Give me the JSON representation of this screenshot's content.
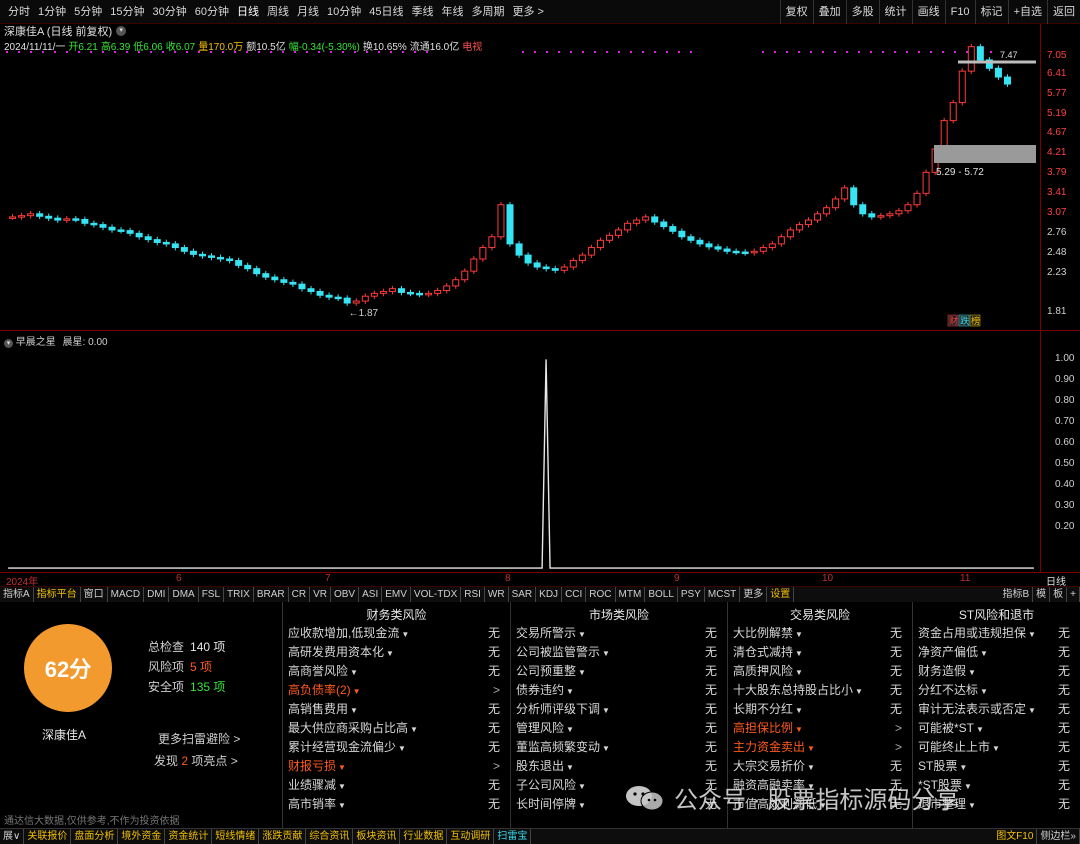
{
  "periods": [
    "分时",
    "1分钟",
    "5分钟",
    "15分钟",
    "30分钟",
    "60分钟",
    "日线",
    "周线",
    "月线",
    "10分钟",
    "45日线",
    "季线",
    "年线",
    "多周期",
    "更多 >"
  ],
  "active_period": "日线",
  "tools": [
    "复权",
    "叠加",
    "多股",
    "统计",
    "画线",
    "F10",
    "标记",
    "+自选",
    "返回"
  ],
  "stock": {
    "title": "深康佳A (日线 前复权)"
  },
  "quote": {
    "date": "2024/11/11/一",
    "open": "开6.21",
    "high": "高6.39",
    "low": "低6.06",
    "close": "收6.07",
    "volume": "量170.0万",
    "amount": "额10.5亿",
    "change": "幅-0.34(-5.30%)",
    "turnover": "换10.65%",
    "float": "流通16.0亿",
    "sector": "电视"
  },
  "colors": {
    "up": "#ff3b3b",
    "down": "#36e4f4",
    "accent": "#f39a2e",
    "warn": "#ff5a1e",
    "bg": "#000000"
  },
  "price_axis": [
    "7.05",
    "6.41",
    "5.77",
    "5.19",
    "4.67",
    "4.21",
    "3.79",
    "3.41",
    "3.07",
    "2.76",
    "2.48",
    "2.23",
    "1.81"
  ],
  "annotations": {
    "low": "←1.87",
    "range": "5.29 - 5.72",
    "high_note": "7.47"
  },
  "badges": {
    "tag1": "财",
    "tag2": "跌",
    "tag3": "榜"
  },
  "indicator": {
    "name": "早晨之星",
    "label": "晨星: 0.00"
  },
  "ind_axis": [
    "1.00",
    "0.90",
    "0.80",
    "0.70",
    "0.60",
    "0.50",
    "0.40",
    "0.30",
    "0.20"
  ],
  "dates": [
    "2024年",
    "6",
    "7",
    "8",
    "9",
    "10",
    "11"
  ],
  "date_axis_label": "日线",
  "ind_tabs": [
    "指标A",
    "指标平台",
    "窗口",
    "MACD",
    "DMI",
    "DMA",
    "FSL",
    "TRIX",
    "BRAR",
    "CR",
    "VR",
    "OBV",
    "ASI",
    "EMV",
    "VOL-TDX",
    "RSI",
    "WR",
    "SAR",
    "KDJ",
    "CCI",
    "ROC",
    "MTM",
    "BOLL",
    "PSY",
    "MCST",
    "更多",
    "设置"
  ],
  "ind_tabs_right": [
    "指标B",
    "模",
    "板",
    "+"
  ],
  "chart_data": {
    "type": "candlestick",
    "x": [
      "2024-05",
      "2024-06",
      "2024-07",
      "2024-08",
      "2024-09",
      "2024-10",
      "2024-11"
    ],
    "y_ticks": [
      7.05,
      6.41,
      5.77,
      5.19,
      4.67,
      4.21,
      3.79,
      3.41,
      3.07,
      2.76,
      2.48,
      2.23,
      1.81
    ],
    "y_scale": "log",
    "ylim": [
      1.7,
      8.0
    ],
    "low_value": 1.87,
    "last": {
      "open": 6.21,
      "high": 6.39,
      "low": 6.06,
      "close": 6.07
    },
    "close_series": [
      3.0,
      3.02,
      3.05,
      3.01,
      2.98,
      2.95,
      2.97,
      2.96,
      2.9,
      2.88,
      2.84,
      2.8,
      2.79,
      2.75,
      2.7,
      2.66,
      2.62,
      2.6,
      2.55,
      2.5,
      2.46,
      2.44,
      2.42,
      2.4,
      2.38,
      2.32,
      2.28,
      2.22,
      2.18,
      2.15,
      2.12,
      2.1,
      2.05,
      2.02,
      1.98,
      1.96,
      1.95,
      1.9,
      1.92,
      1.97,
      2.0,
      2.02,
      2.05,
      2.01,
      2.0,
      1.99,
      2.0,
      2.03,
      2.08,
      2.15,
      2.25,
      2.4,
      2.55,
      2.7,
      3.2,
      2.6,
      2.45,
      2.35,
      2.3,
      2.28,
      2.26,
      2.3,
      2.38,
      2.45,
      2.55,
      2.65,
      2.72,
      2.8,
      2.9,
      2.95,
      3.0,
      2.92,
      2.85,
      2.78,
      2.7,
      2.65,
      2.6,
      2.56,
      2.53,
      2.5,
      2.49,
      2.48,
      2.5,
      2.55,
      2.6,
      2.7,
      2.8,
      2.88,
      2.95,
      3.05,
      3.15,
      3.3,
      3.5,
      3.2,
      3.05,
      3.0,
      3.02,
      3.05,
      3.1,
      3.2,
      3.4,
      3.8,
      4.3,
      5.0,
      5.5,
      6.5,
      7.4,
      6.9,
      6.6,
      6.3,
      6.07
    ],
    "indicator_series": {
      "name": "晨星",
      "peak_index": 59,
      "peak_value": 1.0,
      "baseline": 0.0
    },
    "ind_ylim": [
      0.0,
      1.05
    ]
  },
  "radar": {
    "score": "62分",
    "stock": "深康佳A",
    "total_label": "总检查",
    "total_value": "140 项",
    "risk_label": "风险项",
    "risk_value": "5 项",
    "safe_label": "安全项",
    "safe_value": "135 项",
    "more": "更多扫雷避险 >",
    "found_prefix": "发现",
    "found_count": "2",
    "found_suffix": "项亮点 >",
    "disclaimer": "通达信大数据,仅供参考,不作为投资依据"
  },
  "categories": [
    {
      "title": "财务类风险",
      "items": [
        {
          "label": "应收款增加,低现金流",
          "status": "无",
          "warn": false
        },
        {
          "label": "高研发费用资本化",
          "status": "无",
          "warn": false
        },
        {
          "label": "高商誉风险",
          "status": "无",
          "warn": false
        },
        {
          "label": "高负债率(2)",
          "status": ">",
          "warn": true
        },
        {
          "label": "高销售费用",
          "status": "无",
          "warn": false
        },
        {
          "label": "最大供应商采购占比高",
          "status": "无",
          "warn": false
        },
        {
          "label": "累计经营现金流偏少",
          "status": "无",
          "warn": false
        },
        {
          "label": "财报亏损",
          "status": ">",
          "warn": true
        },
        {
          "label": "业绩骤减",
          "status": "无",
          "warn": false
        },
        {
          "label": "高市销率",
          "status": "无",
          "warn": false
        }
      ]
    },
    {
      "title": "市场类风险",
      "items": [
        {
          "label": "交易所警示",
          "status": "无",
          "warn": false
        },
        {
          "label": "公司被监管警示",
          "status": "无",
          "warn": false
        },
        {
          "label": "公司预重整",
          "status": "无",
          "warn": false
        },
        {
          "label": "债券违约",
          "status": "无",
          "warn": false
        },
        {
          "label": "分析师评级下调",
          "status": "无",
          "warn": false
        },
        {
          "label": "管理风险",
          "status": "无",
          "warn": false
        },
        {
          "label": "董监高频繁变动",
          "status": "无",
          "warn": false
        },
        {
          "label": "股东退出",
          "status": "无",
          "warn": false
        },
        {
          "label": "子公司风险",
          "status": "无",
          "warn": false
        },
        {
          "label": "长时间停牌",
          "status": "无",
          "warn": false
        }
      ]
    },
    {
      "title": "交易类风险",
      "items": [
        {
          "label": "大比例解禁",
          "status": "无",
          "warn": false
        },
        {
          "label": "清仓式减持",
          "status": "无",
          "warn": false
        },
        {
          "label": "高质押风险",
          "status": "无",
          "warn": false
        },
        {
          "label": "十大股东总持股占比小",
          "status": "无",
          "warn": false
        },
        {
          "label": "长期不分红",
          "status": "无",
          "warn": false
        },
        {
          "label": "高担保比例",
          "status": ">",
          "warn": true
        },
        {
          "label": "主力资金卖出",
          "status": ">",
          "warn": true
        },
        {
          "label": "大宗交易折价",
          "status": "无",
          "warn": false
        },
        {
          "label": "融资高融卖率",
          "status": "无",
          "warn": false
        },
        {
          "label": "市值高效利润低",
          "status": "无",
          "warn": false
        }
      ]
    },
    {
      "title": "ST风险和退市",
      "items": [
        {
          "label": "资金占用或违规担保",
          "status": "无",
          "warn": false
        },
        {
          "label": "净资产偏低",
          "status": "无",
          "warn": false
        },
        {
          "label": "财务造假",
          "status": "无",
          "warn": false
        },
        {
          "label": "分红不达标",
          "status": "无",
          "warn": false
        },
        {
          "label": "审计无法表示或否定",
          "status": "无",
          "warn": false
        },
        {
          "label": "可能被*ST",
          "status": "无",
          "warn": false
        },
        {
          "label": "可能终止上市",
          "status": "无",
          "warn": false
        },
        {
          "label": "ST股票",
          "status": "无",
          "warn": false
        },
        {
          "label": "*ST股票",
          "status": "无",
          "warn": false
        },
        {
          "label": "退市整理",
          "status": "无",
          "warn": false
        }
      ]
    }
  ],
  "watermark": "公众号 · 股票指标源码分享",
  "bottom_tabs": [
    "展∨",
    "关联报价",
    "盘面分析",
    "境外资金",
    "资金统计",
    "短线情绪",
    "涨跌贡献",
    "综合资讯",
    "板块资讯",
    "行业数据",
    "互动调研",
    "扫雷宝"
  ],
  "bottom_right": [
    "图文F10",
    "侧边栏»"
  ]
}
